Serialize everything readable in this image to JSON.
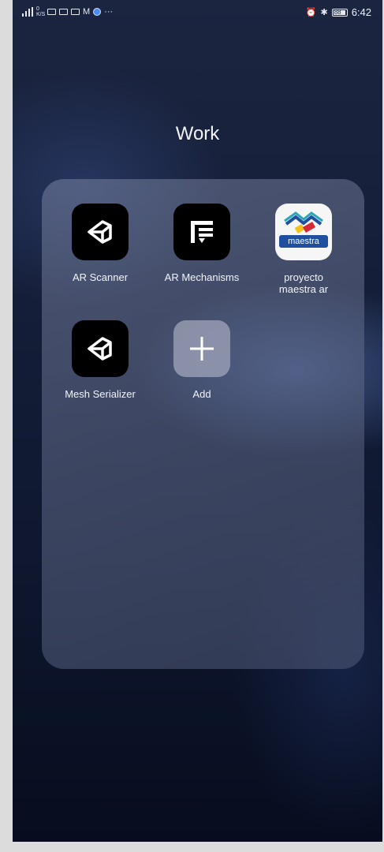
{
  "status_bar": {
    "left_icons": [
      "signal-icon",
      "data-speed-icon",
      "video-icon",
      "screen-icon",
      "mail-icon",
      "gmail-icon",
      "blue-app-icon",
      "more-icon"
    ],
    "data_speed_text": "0\nK/S",
    "more_text": "···",
    "right_icons": [
      "alarm-icon",
      "bluetooth-icon",
      "battery-icon"
    ],
    "battery_text": "88",
    "time": "6:42"
  },
  "folder": {
    "title": "Work",
    "apps": [
      {
        "label": "AR Scanner",
        "icon": "unity-icon"
      },
      {
        "label": "AR Mechanisms",
        "icon": "mechanisms-icon"
      },
      {
        "label": "proyecto maestra ar",
        "icon": "maestra-icon",
        "icon_text": "maestra"
      },
      {
        "label": "Mesh Serializer",
        "icon": "unity-icon"
      },
      {
        "label": "Add",
        "icon": "plus-icon"
      }
    ]
  },
  "colors": {
    "folder_bg": "#6e7896",
    "maestra_blue": "#1f4f9e",
    "maestra_red": "#d32a36",
    "maestra_yellow": "#f2c21a",
    "maestra_teal": "#2aa6b8"
  }
}
